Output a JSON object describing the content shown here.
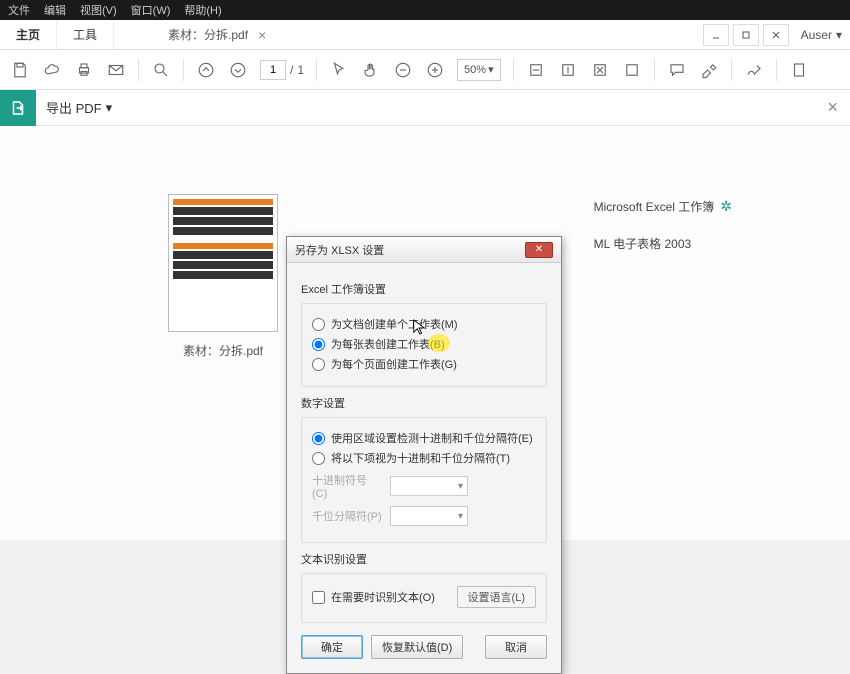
{
  "menu": {
    "file": "文件",
    "edit": "编辑",
    "view": "视图(V)",
    "window": "窗口(W)",
    "help": "帮助(H)"
  },
  "tabs": {
    "home": "主页",
    "tools": "工具"
  },
  "doc_tab": {
    "name": "素材：分拆.pdf",
    "close": "×"
  },
  "user": {
    "name": "Auser",
    "chevron": "▾"
  },
  "toolbar": {
    "page_current": "1",
    "page_sep": "/",
    "page_total": "1",
    "zoom": "50%",
    "zoom_chevron": "▾"
  },
  "export": {
    "label": "导出 PDF",
    "chevron": "▾",
    "close": "×"
  },
  "thumb": {
    "caption": "素材：分拆.pdf"
  },
  "side": {
    "row1": "Microsoft Excel 工作簿",
    "row2": "ML 电子表格 2003"
  },
  "dialog": {
    "title": "另存为 XLSX 设置",
    "sec_workbook": "Excel 工作簿设置",
    "opt_single": "为文档创建单个工作表(M)",
    "opt_each_table": "为每张表创建工作表(B)",
    "opt_each_page": "为每个页面创建工作表(G)",
    "sec_number": "数字设置",
    "opt_locale": "使用区域设置检测十进制和千位分隔符(E)",
    "opt_custom": "将以下项视为十进制和千位分隔符(T)",
    "lbl_decimal": "十进制符号(C)",
    "lbl_thousand": "千位分隔符(P)",
    "sec_ocr": "文本识别设置",
    "chk_ocr": "在需要时识别文本(O)",
    "btn_lang": "设置语言(L)",
    "btn_ok": "确定",
    "btn_restore": "恢复默认值(D)",
    "btn_cancel": "取消",
    "combo_chevron": "▾"
  }
}
